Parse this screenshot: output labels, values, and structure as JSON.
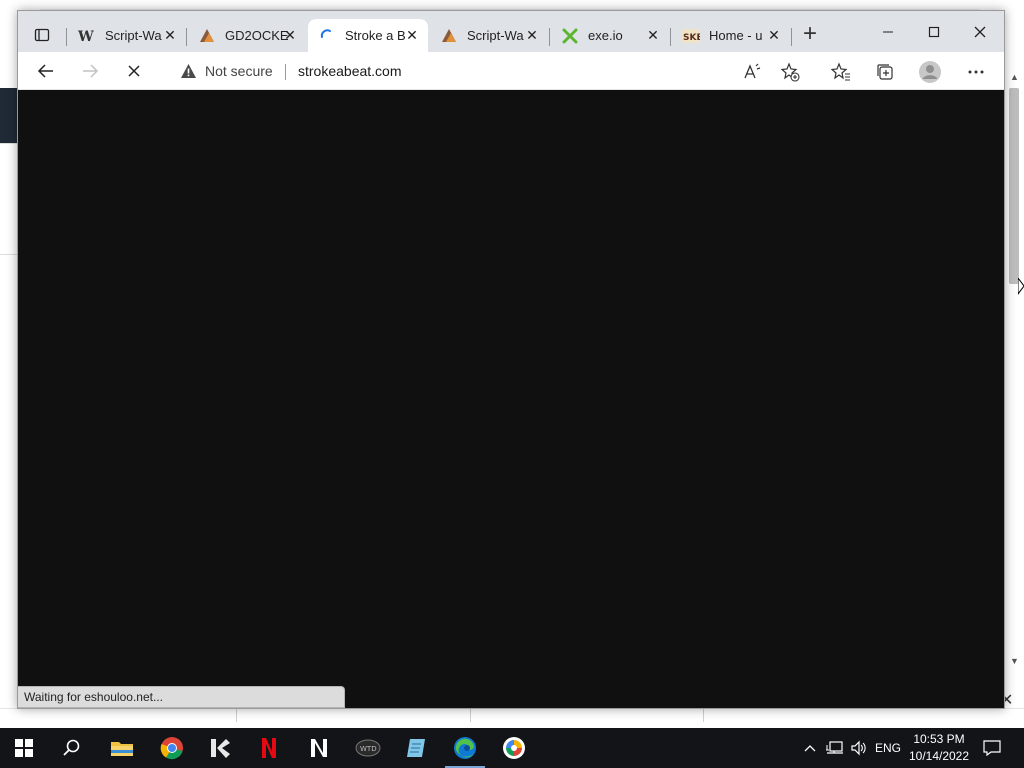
{
  "browser": {
    "tabs": [
      {
        "title": "Script-Wa",
        "icon": "w-favicon-icon",
        "active": false
      },
      {
        "title": "GD2OCKE",
        "icon": "gd-favicon-icon",
        "active": false
      },
      {
        "title": "Stroke a B",
        "icon": "loading-spinner-icon",
        "active": true
      },
      {
        "title": "Script-Wa",
        "icon": "gd-favicon-icon",
        "active": false
      },
      {
        "title": "exe.io",
        "icon": "exe-favicon-icon",
        "active": false
      },
      {
        "title": "Home - u",
        "icon": "home-favicon-icon",
        "active": false
      }
    ],
    "address": {
      "security_label": "Not secure",
      "url": "strokeabeat.com"
    },
    "status_text": "Waiting for eshouloo.net..."
  },
  "taskbar": {
    "apps": [
      "windows-start-icon",
      "search-icon",
      "file-explorer-icon",
      "chrome-icon",
      "kodi-icon",
      "netflix-icon",
      "notion-icon",
      "wtd-icon",
      "notepad-icon",
      "edge-icon",
      "brave-icon"
    ],
    "language": "ENG",
    "time": "10:53 PM",
    "date": "10/14/2022"
  },
  "colors": {
    "content_bg": "#101010",
    "tabstrip_bg": "#dfe3e8",
    "taskbar_bg": "#131418"
  }
}
